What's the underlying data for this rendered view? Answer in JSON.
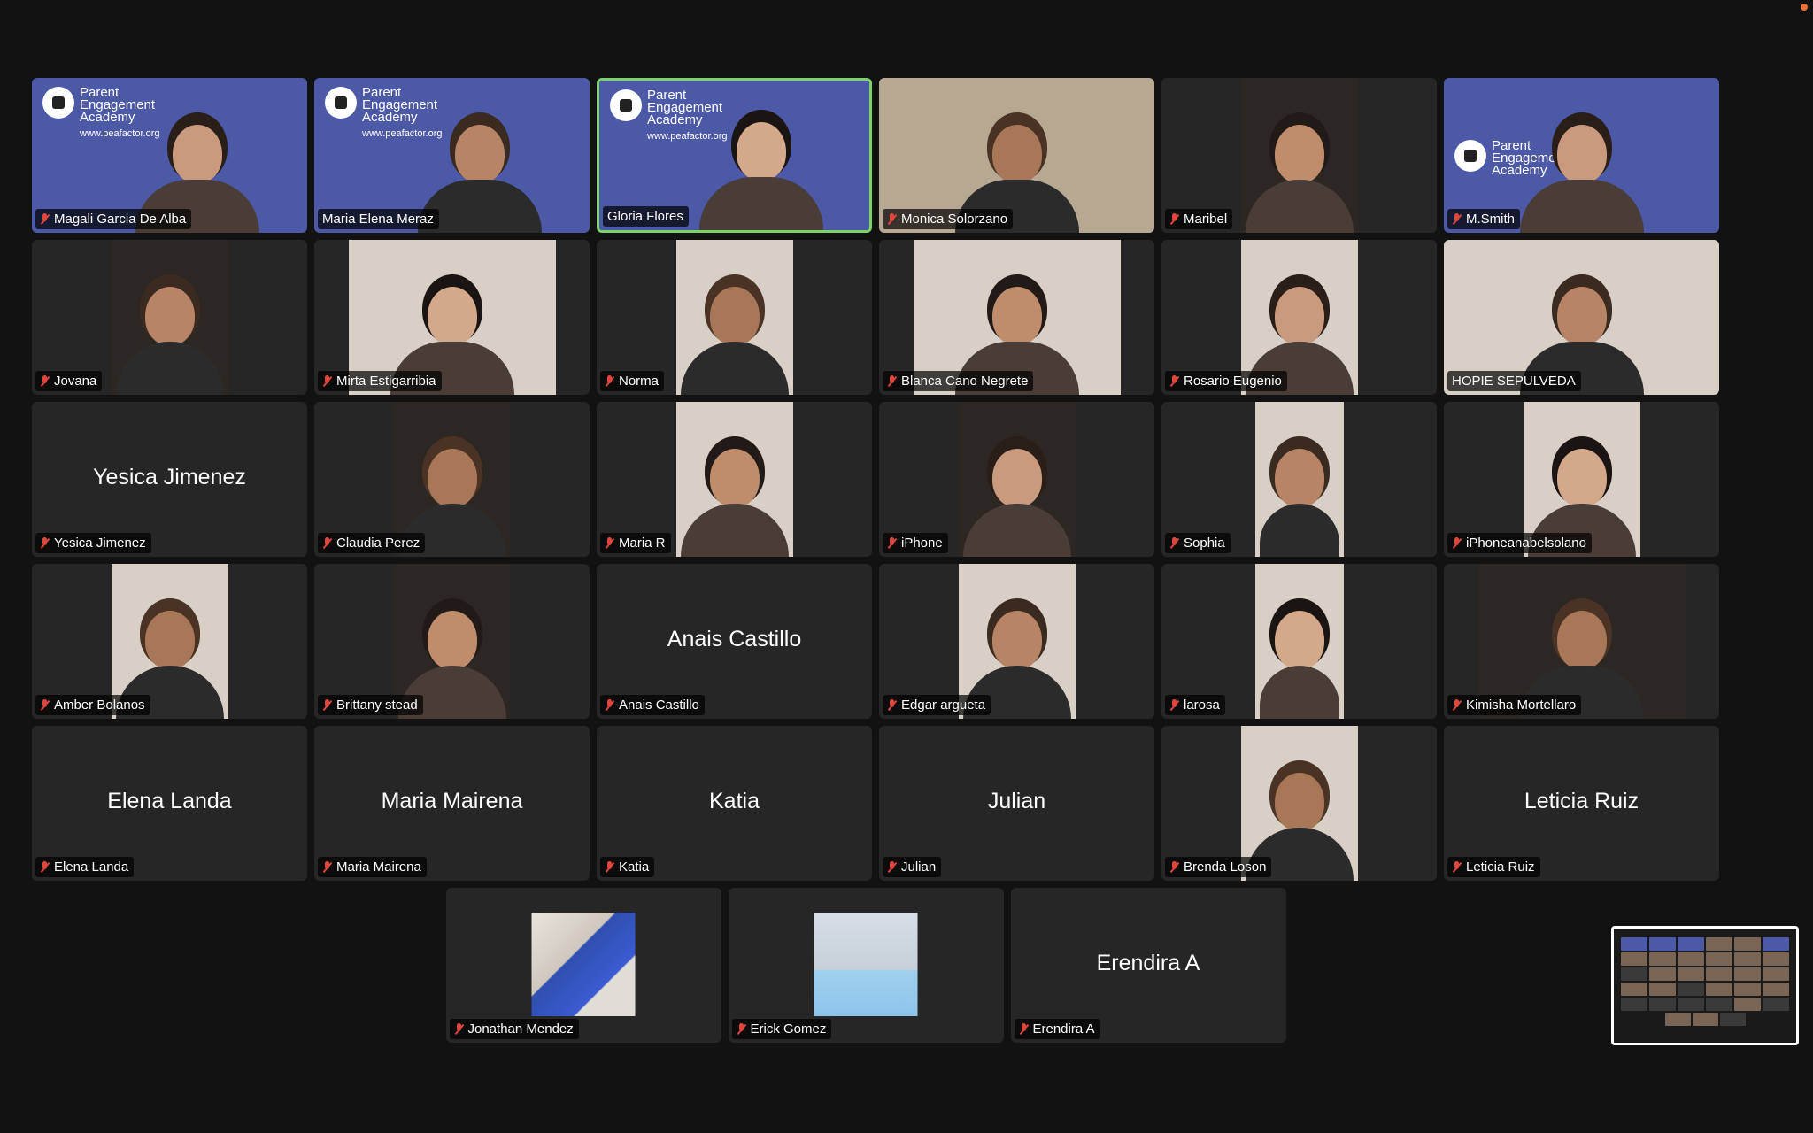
{
  "meeting": {
    "rows": [
      [
        {
          "label": "Magali Garcia De Alba",
          "kind": "video",
          "muted": true,
          "bg": "blue",
          "pea": true
        },
        {
          "label": "Maria Elena Meraz",
          "kind": "video",
          "muted": false,
          "bg": "blue",
          "pea": true
        },
        {
          "label": "Gloria Flores",
          "kind": "video",
          "muted": false,
          "bg": "blue",
          "pea": true,
          "active": true
        },
        {
          "label": "Monica Solorzano",
          "kind": "video",
          "muted": true,
          "bg": "room"
        },
        {
          "label": "Maribel",
          "kind": "video",
          "muted": true,
          "bg": "dark",
          "narrow": true
        },
        {
          "label": "M.Smith",
          "kind": "video",
          "muted": true,
          "bg": "blue",
          "pea": true,
          "pea_center": true
        }
      ],
      [
        {
          "label": "Jovana",
          "kind": "video",
          "muted": true,
          "bg": "dark",
          "narrow": true
        },
        {
          "label": "Mirta Estigarribia",
          "kind": "video",
          "muted": true,
          "bg": "light",
          "mid": true
        },
        {
          "label": "Norma",
          "kind": "video",
          "muted": true,
          "bg": "light",
          "narrow": true
        },
        {
          "label": "Blanca Cano Negrete",
          "kind": "video",
          "muted": true,
          "bg": "light",
          "mid": true
        },
        {
          "label": "Rosario Eugenio",
          "kind": "video",
          "muted": true,
          "bg": "light",
          "narrow": true
        },
        {
          "label": "HOPIE SEPULVEDA",
          "kind": "video",
          "muted": false,
          "bg": "light"
        }
      ],
      [
        {
          "label": "Yesica Jimenez",
          "kind": "name",
          "muted": true,
          "center": "Yesica Jimenez"
        },
        {
          "label": "Claudia Perez",
          "kind": "video",
          "muted": true,
          "bg": "dark",
          "narrow": true
        },
        {
          "label": "Maria R",
          "kind": "video",
          "muted": true,
          "bg": "light",
          "narrow": true
        },
        {
          "label": "iPhone",
          "kind": "video",
          "muted": true,
          "bg": "dark",
          "narrow": true
        },
        {
          "label": "Sophia",
          "kind": "video",
          "muted": true,
          "bg": "light",
          "narrower": true
        },
        {
          "label": "iPhoneanabelsolano",
          "kind": "video",
          "muted": true,
          "bg": "light",
          "narrow": true
        }
      ],
      [
        {
          "label": "Amber Bolanos",
          "kind": "video",
          "muted": true,
          "bg": "light",
          "narrow": true
        },
        {
          "label": "Brittany stead",
          "kind": "video",
          "muted": true,
          "bg": "dark",
          "narrow": true
        },
        {
          "label": "Anais Castillo",
          "kind": "name",
          "muted": true,
          "center": "Anais Castillo"
        },
        {
          "label": "Edgar argueta",
          "kind": "video",
          "muted": true,
          "bg": "light",
          "narrow": true
        },
        {
          "label": "larosa",
          "kind": "video",
          "muted": true,
          "bg": "light",
          "narrower": true
        },
        {
          "label": "Kimisha Mortellaro",
          "kind": "video",
          "muted": true,
          "bg": "dark",
          "mid": true
        }
      ],
      [
        {
          "label": "Elena Landa",
          "kind": "name",
          "muted": true,
          "center": "Elena Landa"
        },
        {
          "label": "Maria Mairena",
          "kind": "name",
          "muted": true,
          "center": "Maria Mairena"
        },
        {
          "label": "Katia",
          "kind": "name",
          "muted": true,
          "center": "Katia"
        },
        {
          "label": "Julian",
          "kind": "name",
          "muted": true,
          "center": "Julian"
        },
        {
          "label": "Brenda Loson",
          "kind": "video",
          "muted": true,
          "bg": "light",
          "narrow": true
        },
        {
          "label": "Leticia Ruiz",
          "kind": "name",
          "muted": true,
          "center": "Leticia Ruiz"
        }
      ],
      [
        {
          "label": "Jonathan Mendez",
          "kind": "avatar",
          "muted": true,
          "bg": "art"
        },
        {
          "label": "Erick Gomez",
          "kind": "avatar",
          "muted": true,
          "bg": "photo"
        },
        {
          "label": "Erendira A",
          "kind": "name",
          "muted": true,
          "center": "Erendira A"
        }
      ]
    ],
    "pea_logo": {
      "line1": "Parent",
      "line2": "Engagement",
      "line3": "Academy",
      "url": "www.peafactor.org"
    },
    "colors": {
      "background": "#121212",
      "tile": "#262626",
      "active_speaker": "#7dd36a",
      "muted_icon": "#e0473c",
      "pea_blue": "#4b59a6"
    }
  }
}
